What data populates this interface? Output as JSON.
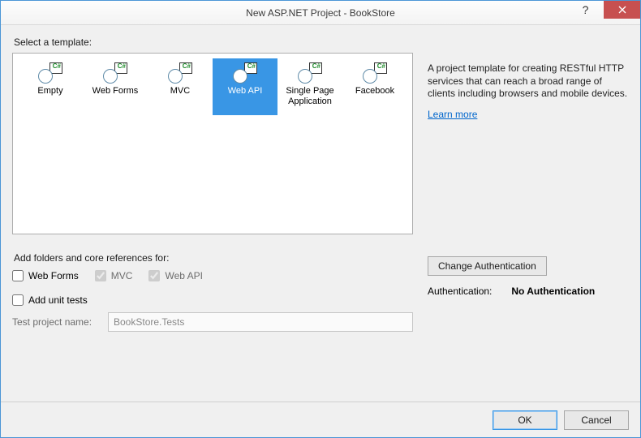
{
  "title": "New ASP.NET Project - BookStore",
  "select_template_label": "Select a template:",
  "templates": [
    {
      "label": "Empty",
      "selected": false
    },
    {
      "label": "Web Forms",
      "selected": false
    },
    {
      "label": "MVC",
      "selected": false
    },
    {
      "label": "Web API",
      "selected": true
    },
    {
      "label": "Single Page Application",
      "selected": false
    },
    {
      "label": "Facebook",
      "selected": false
    }
  ],
  "description": "A project template for creating RESTful HTTP services that can reach a broad range of clients including browsers and mobile devices.",
  "learn_more": "Learn more",
  "refs_label": "Add folders and core references for:",
  "refs": {
    "web_forms": {
      "label": "Web Forms",
      "checked": false,
      "enabled": true
    },
    "mvc": {
      "label": "MVC",
      "checked": true,
      "enabled": false
    },
    "web_api": {
      "label": "Web API",
      "checked": true,
      "enabled": false
    }
  },
  "unit_tests": {
    "label": "Add unit tests",
    "checked": false
  },
  "test_project_label": "Test project name:",
  "test_project_value": "BookStore.Tests",
  "change_auth_label": "Change Authentication",
  "auth_label": "Authentication:",
  "auth_value": "No Authentication",
  "buttons": {
    "ok": "OK",
    "cancel": "Cancel"
  }
}
